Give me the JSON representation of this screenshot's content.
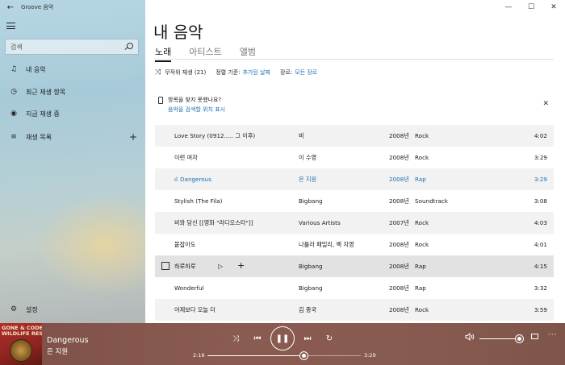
{
  "window": {
    "title": "Groove 음악",
    "back_icon": "←",
    "minimize_icon": "—",
    "maximize_icon": "☐",
    "close_icon": "✕"
  },
  "sidebar": {
    "search_placeholder": "검색",
    "items": [
      {
        "icon": "♫",
        "label": "내 음악"
      },
      {
        "icon": "◷",
        "label": "최근 재생 항목"
      },
      {
        "icon": "◉",
        "label": "지금 재생 중"
      },
      {
        "icon": "≡",
        "label": "재생 목록",
        "action": "+"
      }
    ],
    "settings": {
      "icon": "⚙",
      "label": "설정"
    }
  },
  "content": {
    "title": "내 음악",
    "tabs": [
      {
        "label": "노래",
        "active": true
      },
      {
        "label": "아티스트",
        "active": false
      },
      {
        "label": "앨범",
        "active": false
      }
    ],
    "filters": {
      "shuffle_icon": "⤨",
      "shuffle_label": "무작위 재생 (21)",
      "sort_label": "정렬 기준:",
      "sort_value": "추가된 날짜",
      "genre_label": "장르:",
      "genre_value": "모든 장르"
    },
    "notice": {
      "title": "항목을 찾지 못했나요?",
      "link": "음악을 검색할 위치 표시",
      "close_icon": "✕"
    },
    "songs": [
      {
        "title": "Love Story (0912..... 그 이후)",
        "artist": "비",
        "year": "2008년",
        "genre": "Rock",
        "time": "4:02"
      },
      {
        "title": "이런 여자",
        "artist": "이 수영",
        "year": "2008년",
        "genre": "Rock",
        "time": "3:29"
      },
      {
        "title": "Dangerous",
        "artist": "은 지원",
        "year": "2008년",
        "genre": "Rap",
        "time": "3:29",
        "playing": true,
        "eq_icon": "ıl"
      },
      {
        "title": "Stylish (The Fila)",
        "artist": "Bigbang",
        "year": "2008년",
        "genre": "Soundtrack",
        "time": "3:08"
      },
      {
        "title": "비와 당신 [[영화 \"라디오스타\"]]",
        "artist": "Various Artists",
        "year": "2007년",
        "genre": "Rock",
        "time": "4:03"
      },
      {
        "title": "붙잡아도",
        "artist": "나플라 패밀리, 백 지영",
        "year": "2008년",
        "genre": "Rock",
        "time": "4:01"
      },
      {
        "title": "하루하루",
        "artist": "Bigbang",
        "year": "2008년",
        "genre": "Rap",
        "time": "4:15",
        "hover": true,
        "play_icon": "▷",
        "add_icon": "+"
      },
      {
        "title": "Wonderful",
        "artist": "Bigbang",
        "year": "2008년",
        "genre": "Rap",
        "time": "3:32"
      },
      {
        "title": "어제보다 오늘 더",
        "artist": "김 종국",
        "year": "2008년",
        "genre": "Rock",
        "time": "3:59"
      }
    ]
  },
  "player": {
    "album_art_text": "GONE & CODE\nWILDLIFE RESERVE",
    "now_playing_title": "Dangerous",
    "now_playing_artist": "은 지원",
    "shuffle_icon": "⤨",
    "prev_icon": "⏮",
    "pause_icon": "❚❚",
    "next_icon": "⏭",
    "repeat_icon": "↻",
    "elapsed": "2:16",
    "duration": "3:29",
    "progress_fraction": 0.63,
    "volume_icon": "🔊",
    "volume_fraction": 0.99,
    "more_icon": "···"
  },
  "colors": {
    "accent": "#1a6fb5",
    "player_bg": "#8a5b50"
  }
}
